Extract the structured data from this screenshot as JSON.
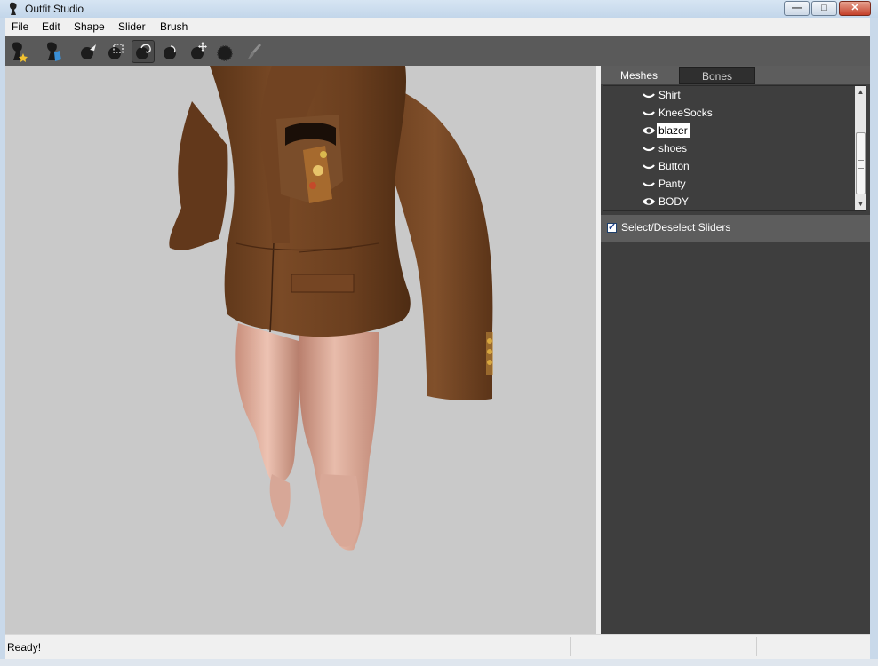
{
  "window": {
    "title": "Outfit Studio",
    "controls": {
      "minimize": "—",
      "maximize": "□",
      "close": "✕"
    }
  },
  "menu": [
    "File",
    "Edit",
    "Shape",
    "Slider",
    "Brush"
  ],
  "toolbar": {
    "tools": [
      "outfit-view-icon",
      "reference-view-icon",
      "select-brush-icon",
      "mask-brush-icon",
      "inflate-brush-icon",
      "deflate-brush-icon",
      "move-brush-icon",
      "smooth-brush-icon",
      "weight-paint-icon"
    ],
    "active_tool": "inflate-brush-icon"
  },
  "panel": {
    "tabs": [
      "Meshes",
      "Bones"
    ],
    "active_tab": "Meshes",
    "meshes": [
      {
        "label": "Shirt",
        "visible": false,
        "selected": false
      },
      {
        "label": "KneeSocks",
        "visible": false,
        "selected": false
      },
      {
        "label": "blazer",
        "visible": true,
        "selected": true
      },
      {
        "label": "shoes",
        "visible": false,
        "selected": false
      },
      {
        "label": "Button",
        "visible": false,
        "selected": false
      },
      {
        "label": "Panty",
        "visible": false,
        "selected": false
      },
      {
        "label": "BODY",
        "visible": true,
        "selected": false
      }
    ],
    "select_sliders_label": "Select/Deselect Sliders",
    "select_sliders_checked": true
  },
  "status": {
    "text": "Ready!"
  },
  "colors": {
    "blazer_brown": "#6e4020",
    "skin": "#d9a995",
    "viewport_bg": "#c9c9c9",
    "panel_bg": "#3e3e3e"
  }
}
